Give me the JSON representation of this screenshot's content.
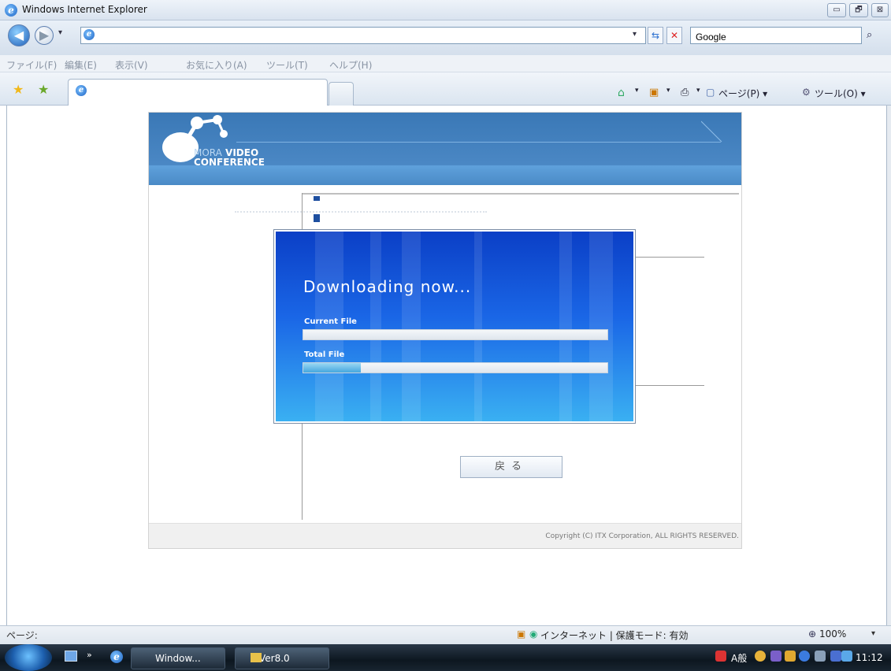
{
  "window": {
    "title": "Windows Internet Explorer",
    "min_label": "▭",
    "restore_label": "🗗",
    "close_label": "⊠"
  },
  "address": {
    "value": "",
    "search_value": "Google"
  },
  "menu": [
    "ファイル(F)",
    "編集(E)",
    "表示(V)",
    "お気に入り(A)",
    "ツール(T)",
    "ヘルプ(H)"
  ],
  "commands": {
    "page_label": "ページ(P) ▾",
    "tools_label": "ツール(O) ▾"
  },
  "page": {
    "logo_line1_light": "MORA",
    "logo_line1": "VIDEO",
    "logo_line2": "CONFERENCE",
    "back_button": "戻る",
    "copyright": "Copyright (C) ITX Corporation, ALL RIGHTS RESERVED."
  },
  "dialog": {
    "title": "Downloading now...",
    "current_label": "Current File",
    "current_progress": 0.0,
    "total_label": "Total File",
    "total_progress": 0.19
  },
  "status": {
    "left": "ページ:",
    "zone": "インターネット | 保護モード: 有効",
    "zoom": "100%"
  },
  "taskbar": {
    "item1": "Window...",
    "item2": "Ver8.0",
    "tray_text": "A般",
    "clock": "11:12"
  },
  "colors": {
    "dialog_top": "#0b3fc6",
    "dialog_bottom": "#3ab0f2",
    "banner": "#3a78b6"
  }
}
